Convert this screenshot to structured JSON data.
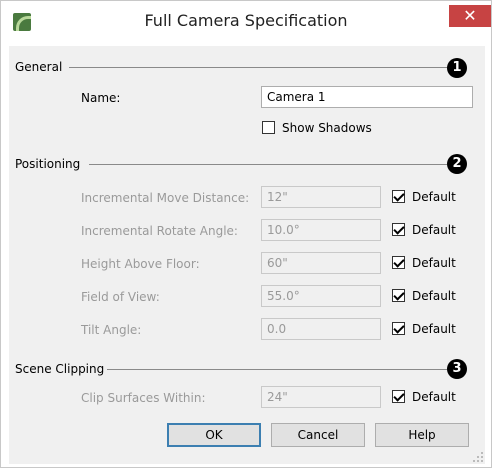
{
  "window": {
    "title": "Full Camera Specification",
    "close_glyph": "✕"
  },
  "general": {
    "title": "General",
    "badge": "1",
    "name_label": "Name:",
    "name_value": "Camera 1",
    "show_shadows_label": "Show Shadows",
    "show_shadows_checked": false
  },
  "positioning": {
    "title": "Positioning",
    "badge": "2",
    "rows": [
      {
        "label": "Incremental Move Distance:",
        "value": "12\"",
        "default_label": "Default",
        "default_checked": true
      },
      {
        "label": "Incremental Rotate Angle:",
        "value": "10.0°",
        "default_label": "Default",
        "default_checked": true
      },
      {
        "label": "Height Above Floor:",
        "value": "60\"",
        "default_label": "Default",
        "default_checked": true
      },
      {
        "label": "Field of View:",
        "value": "55.0°",
        "default_label": "Default",
        "default_checked": true
      },
      {
        "label": "Tilt Angle:",
        "value": "0.0",
        "default_label": "Default",
        "default_checked": true
      }
    ]
  },
  "scene_clipping": {
    "title": "Scene Clipping",
    "badge": "3",
    "clip_label": "Clip Surfaces Within:",
    "clip_value": "24\"",
    "default_label": "Default",
    "default_checked": true
  },
  "buttons": {
    "ok": "OK",
    "cancel": "Cancel",
    "help": "Help"
  },
  "colors": {
    "close_button": "#c74343",
    "app_icon": "#4a7a3f",
    "default_button_border": "#3c7fb1"
  }
}
